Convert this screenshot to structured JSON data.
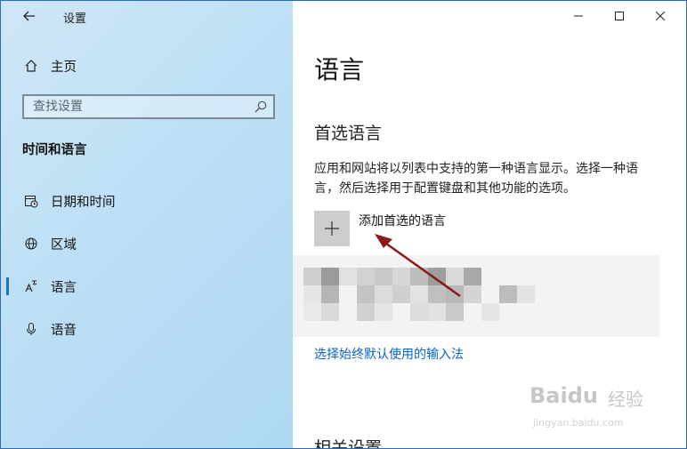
{
  "app": {
    "title": "设置"
  },
  "sidebar": {
    "home_label": "主页",
    "search_placeholder": "查找设置",
    "section_title": "时间和语言",
    "items": [
      {
        "label": "日期和时间",
        "icon": "calendar-clock-icon"
      },
      {
        "label": "区域",
        "icon": "globe-icon"
      },
      {
        "label": "语言",
        "icon": "language-icon",
        "active": true
      },
      {
        "label": "语音",
        "icon": "microphone-icon"
      }
    ]
  },
  "window_controls": {
    "minimize": "—",
    "maximize": "☐",
    "close": "✕"
  },
  "main": {
    "title": "语言",
    "preferred_heading": "首选语言",
    "description": "应用和网站将以列表中支持的第一种语言显示。选择一种语言，然后选择用于配置键盘和其他功能的选项。",
    "add_language_label": "添加首选的语言",
    "add_icon": "plus-icon",
    "input_method_link": "选择始终默认使用的输入法",
    "next_heading": "相关设置"
  },
  "watermark": {
    "brand": "Baidu",
    "cn": "经验",
    "url": "jingyan.baidu.com"
  },
  "colors": {
    "accent": "#1a73c9",
    "link": "#0a63c9",
    "arrow": "#8b1a1a"
  }
}
